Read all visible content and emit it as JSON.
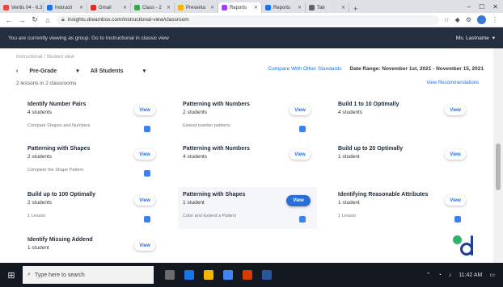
{
  "browser": {
    "tabs": [
      {
        "label": "Ventis 04 - 6.3",
        "color": "#e8453c"
      },
      {
        "label": "Instructi",
        "color": "#1a73e8"
      },
      {
        "label": "Gmail",
        "color": "#d93025"
      },
      {
        "label": "Class - 2",
        "color": "#34a853"
      },
      {
        "label": "Presenta",
        "color": "#f4b400"
      },
      {
        "label": "Reports",
        "color": "#a142f4",
        "active": true
      },
      {
        "label": "Reports",
        "color": "#1a73e8"
      },
      {
        "label": "Tab",
        "color": "#5f6368"
      }
    ],
    "url": "insights.dreambox.com/instructional-view/classroom"
  },
  "app_header": {
    "notice": "You are currently viewing as group. Go to Instructional in classic view",
    "account": "Ms. Lastname"
  },
  "page": {
    "subline": "Instructional / Student view",
    "filter_grade": "Pre-Grade",
    "filter_students": "All Students",
    "date_link": "Compare With Other Standards",
    "date_range": "Date Range: November 1st, 2021 - November 15, 2021",
    "student_count": "2 lessons in 2 classrooms",
    "recap_link": "View Recommendations"
  },
  "cards": [
    {
      "title": "Identify Number Pairs",
      "students": "4 students",
      "meta": "Compare Shapes and Numbers",
      "button": "View"
    },
    {
      "title": "Patterning with Numbers",
      "students": "2 students",
      "meta": "Extend number patterns",
      "button": "View"
    },
    {
      "title": "Build 1 to 10 Optimally",
      "students": "4 students",
      "meta": "",
      "button": "View"
    },
    {
      "title": "Patterning with Shapes",
      "students": "2 students",
      "meta": "Complete the Shape Pattern",
      "button": "View"
    },
    {
      "title": "Patterning with Numbers",
      "students": "4 students",
      "meta": "",
      "button": "View"
    },
    {
      "title": "Build up to 20 Optimally",
      "students": "1 student",
      "meta": "",
      "button": "View"
    },
    {
      "title": "Build up to 100 Optimally",
      "students": "2 students",
      "meta": "1 Lesson",
      "button": "View"
    },
    {
      "title": "Patterning with Shapes",
      "students": "1 student",
      "meta": "Color and Extend a Pattern",
      "button": "View",
      "highlighted": true
    },
    {
      "title": "Identifying Reasonable Attributes",
      "students": "1 student",
      "meta": "1 Lesson",
      "button": "View"
    },
    {
      "title": "Identify Missing Addend",
      "students": "1 student",
      "meta": "",
      "button": "View"
    }
  ],
  "taskbar": {
    "search_placeholder": "Type here to search",
    "time": "11:42 AM"
  }
}
